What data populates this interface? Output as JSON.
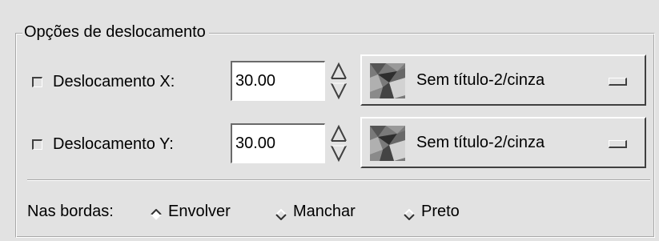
{
  "group": {
    "title": "Opções de deslocamento"
  },
  "rows": [
    {
      "checkbox_checked": false,
      "label": "Deslocamento X:",
      "value": "30.00",
      "map_name": "Sem título-2/cinza"
    },
    {
      "checkbox_checked": false,
      "label": "Deslocamento Y:",
      "value": "30.00",
      "map_name": "Sem título-2/cinza"
    }
  ],
  "edges": {
    "label": "Nas bordas:",
    "options": [
      "Envolver",
      "Manchar",
      "Preto"
    ],
    "selected": "Envolver"
  },
  "icons": {
    "spin": "spin-arrows-icon",
    "thumbnail": "image-thumbnail-icon",
    "menu_indicator": "option-menu-indicator-icon",
    "radio": "radio-diamond-icon"
  },
  "colors": {
    "background": "#e2e2e2",
    "input_bg": "#ffffff",
    "shadow": "#404040",
    "highlight": "#ffffff"
  }
}
